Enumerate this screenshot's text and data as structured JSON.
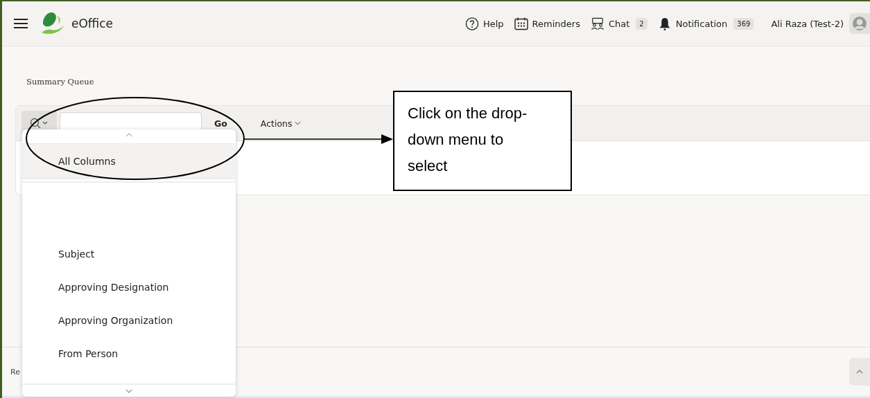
{
  "header": {
    "app_name": "eOffice",
    "links": [
      {
        "kind": "help",
        "label": "Help"
      },
      {
        "kind": "reminders",
        "label": "Reminders"
      },
      {
        "kind": "chat",
        "label": "Chat",
        "badge": "2"
      },
      {
        "kind": "notification",
        "label": "Notification",
        "badge": "369"
      }
    ],
    "user": "Ali Raza (Test-2)"
  },
  "page_title": "Summary Queue",
  "toolbar": {
    "go": "Go",
    "actions": "Actions"
  },
  "column_menu": {
    "items": [
      {
        "label": "All Columns",
        "selected": true
      },
      {
        "label": "Subject",
        "selected": false
      },
      {
        "label": "Approving Designation",
        "selected": false
      },
      {
        "label": "Approving Organization",
        "selected": false
      },
      {
        "label": "From Person",
        "selected": false
      }
    ]
  },
  "footer_text": "Re",
  "callout": "Click on the drop-down menu to select"
}
